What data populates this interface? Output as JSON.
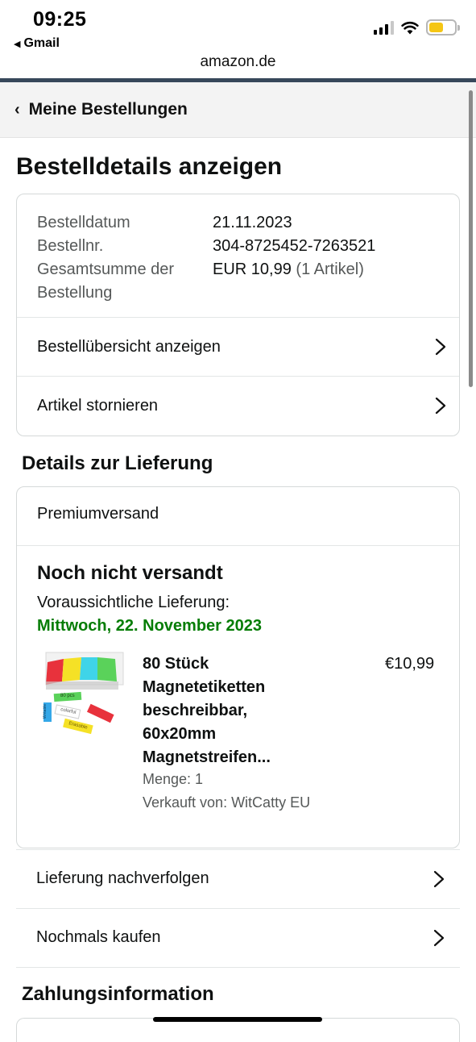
{
  "status_bar": {
    "time": "09:25",
    "back_app": "Gmail",
    "battery_color": "#f5c614"
  },
  "browser": {
    "url": "amazon.de"
  },
  "nav": {
    "back_label": "Meine Bestellungen"
  },
  "page": {
    "title": "Bestelldetails anzeigen"
  },
  "order_summary": {
    "date_label": "Bestelldatum",
    "date_value": "21.11.2023",
    "number_label": "Bestellnr.",
    "number_value": "304-8725452-7263521",
    "total_label": "Gesamtsumme der Bestellung",
    "total_value": "EUR 10,99",
    "total_count": "(1 Artikel)",
    "links": [
      "Bestellübersicht anzeigen",
      "Artikel stornieren"
    ]
  },
  "delivery": {
    "heading": "Details zur Lieferung",
    "shipping_method": "Premiumversand",
    "status": "Noch nicht versandt",
    "expected_label": "Voraussichtliche Lieferung:",
    "expected_date": "Mittwoch, 22. November 2023",
    "item": {
      "title": "80 Stück Magnetetiketten beschreibbar, 60x20mm Magnetstreifen...",
      "price": "€10,99",
      "quantity": "Menge: 1",
      "seller": "Verkauft von: WitCatty EU",
      "image_labels": [
        "80 pcs",
        "colorful",
        "Erasable",
        "Writable"
      ]
    },
    "actions": [
      "Lieferung nachverfolgen",
      "Nochmals kaufen"
    ]
  },
  "payment": {
    "heading": "Zahlungsinformation"
  },
  "colors": {
    "accent_green": "#067d06",
    "header_line": "#37475a",
    "nav_bg": "#f3f3f3"
  }
}
